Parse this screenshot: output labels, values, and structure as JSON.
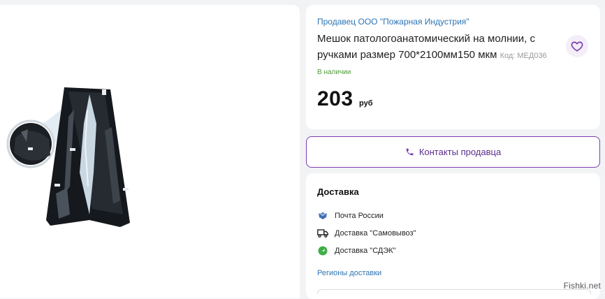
{
  "seller": {
    "label": "Продавец ООО \"Пожарная Индустрия\""
  },
  "product": {
    "title": "Мешок патологоанатомический на молнии, с ручками размер 700*2100мм150 мкм",
    "code": "Код: МЕД036",
    "stock": "В наличии",
    "price": "203",
    "currency": "руб"
  },
  "contact": {
    "label": "Контакты продавца"
  },
  "delivery": {
    "title": "Доставка",
    "options": [
      {
        "label": "Почта России",
        "icon": "russian-post-icon"
      },
      {
        "label": "Доставка \"Самовывоз\"",
        "icon": "truck-icon"
      },
      {
        "label": "Доставка \"СДЭК\"",
        "icon": "cdek-icon"
      }
    ],
    "regions_link": "Регионы доставки"
  },
  "watermark": "Fishki.net",
  "colors": {
    "accent": "#7b3fb0",
    "link": "#2c74b3",
    "stock": "#4f9c3a",
    "background": "#f2f3f5"
  }
}
